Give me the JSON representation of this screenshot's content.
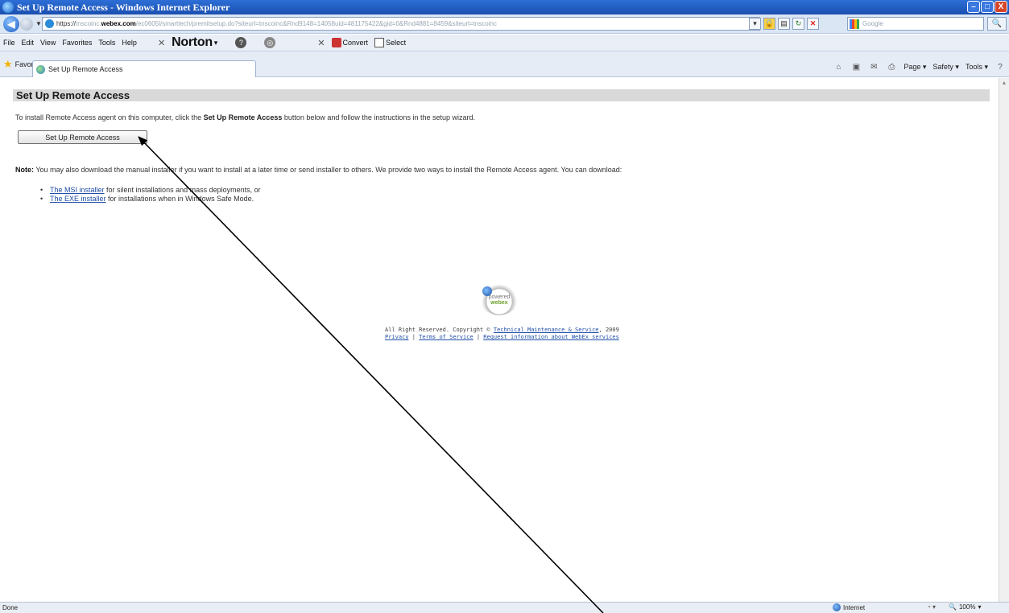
{
  "window": {
    "title": "Set Up Remote Access - Windows Internet Explorer",
    "buttons": {
      "minimize": "–",
      "maximize": "□",
      "close": "X"
    }
  },
  "address_bar": {
    "url_scheme": "https://",
    "url_host_prefix": "tnscoinc.",
    "url_host": "webex.com",
    "url_path": "/ec0605l/smarttech/premitsetup.do?siteurl=tnscoinc&Rnd9148=14058uid=481175422&gid=0&Rnd4881=8459&siteurl=tnscoinc",
    "search_placeholder": "Google",
    "search_button": "🔍"
  },
  "menu_bar": {
    "items": [
      "File",
      "Edit",
      "View",
      "Favorites",
      "Tools",
      "Help"
    ],
    "norton_label": "Norton",
    "convert_label": "Convert",
    "select_label": "Select"
  },
  "favorites_bar": {
    "favorites_label": "Favorites",
    "tab_label": "Set Up Remote Access",
    "commands": {
      "page": "Page ▾",
      "safety": "Safety ▾",
      "tools": "Tools ▾"
    }
  },
  "page": {
    "header": "Set Up Remote Access",
    "intro_before": "To install Remote Access agent on this computer, click the ",
    "intro_bold": "Set Up Remote Access",
    "intro_after": " button below and follow the instructions in the setup wizard.",
    "setup_button": "Set Up Remote Access",
    "note_label": "Note:",
    "note_text": " You may also download the manual installer if you want to install at a later time or send installer to others. We provide two ways to install the Remote Access agent. You can download:",
    "downloads": [
      {
        "link": "The MSI installer",
        "text": " for silent installations and mass deployments, or"
      },
      {
        "link": "The EXE installer",
        "text": " for installations when in Windows Safe Mode."
      }
    ],
    "logo_text_top": "powered",
    "logo_text_bottom": "webex",
    "footer_rights": "All Right Reserved. Copyright © ",
    "footer_company": "Technical Maintenance & Service",
    "footer_year": ", 2009",
    "footer_privacy": "Privacy",
    "footer_sep": " | ",
    "footer_terms": "Terms of Service",
    "footer_request": "Request information about WebEx services"
  },
  "status_bar": {
    "status": "Done",
    "zone": "Internet",
    "zoom": "100%"
  }
}
